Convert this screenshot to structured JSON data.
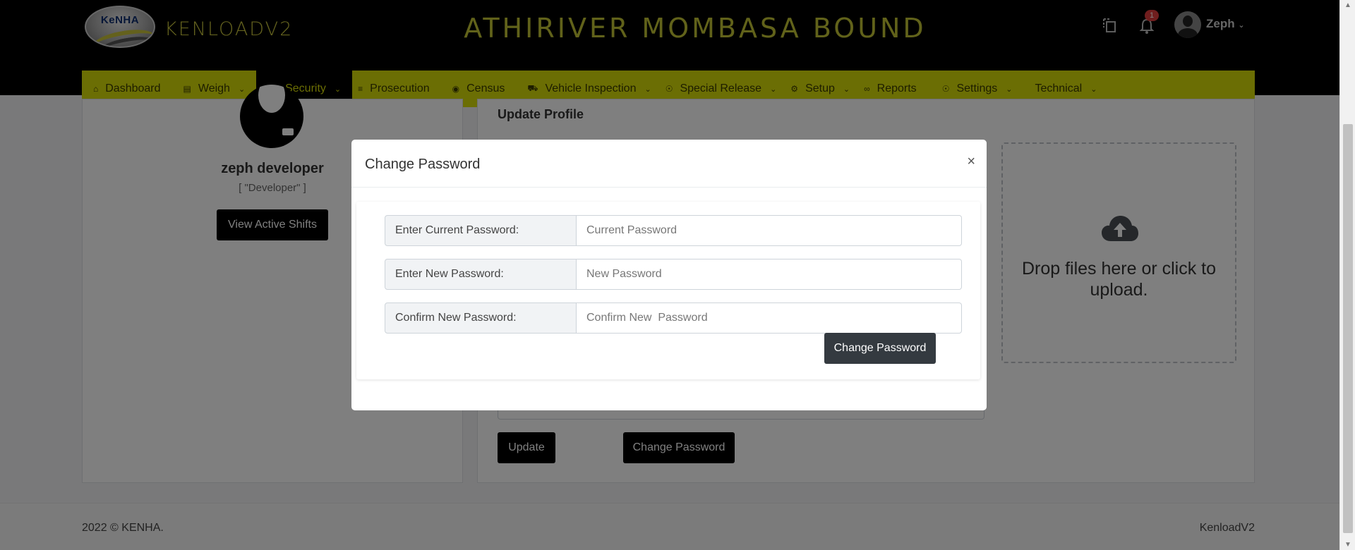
{
  "header": {
    "logo_text": "KeNHA",
    "brand": "KENLOADV2",
    "station": "ATHIRIVER MOMBASA BOUND",
    "notification_count": "1",
    "user_name": "Zeph"
  },
  "nav": {
    "items": [
      {
        "label": "Dashboard",
        "icon": "home-icon",
        "dropdown": false
      },
      {
        "label": "Weigh",
        "icon": "scale-icon",
        "dropdown": true
      },
      {
        "label": "Security",
        "icon": "lock-icon",
        "dropdown": true,
        "active": true
      },
      {
        "label": "Prosecution",
        "icon": "list-icon",
        "dropdown": false
      },
      {
        "label": "Census",
        "icon": "car-icon",
        "dropdown": false
      },
      {
        "label": "Vehicle Inspection",
        "icon": "truck-icon",
        "dropdown": true
      },
      {
        "label": "Special Release",
        "icon": "circle-dot-icon",
        "dropdown": true
      },
      {
        "label": "Setup",
        "icon": "cogs-icon",
        "dropdown": true
      },
      {
        "label": "Reports",
        "icon": "paperclip-icon",
        "dropdown": false
      },
      {
        "label": "Settings",
        "icon": "circle-dot-icon",
        "dropdown": true
      },
      {
        "label": "Technical",
        "icon": "",
        "dropdown": true
      }
    ]
  },
  "profile": {
    "name": "zeph developer",
    "role": "[ \"Developer\" ]",
    "view_shifts_label": "View Active Shifts"
  },
  "form": {
    "title": "Update Profile",
    "dropzone_text": "Drop files here or click to upload.",
    "update_label": "Update",
    "change_password_label": "Change Password"
  },
  "modal": {
    "title": "Change Password",
    "close_glyph": "×",
    "fields": [
      {
        "label": "Enter Current Password:",
        "placeholder": "Current Password",
        "value": ""
      },
      {
        "label": "Enter New Password:",
        "placeholder": "New Password",
        "value": ""
      },
      {
        "label": "Confirm New Password:",
        "placeholder": "Confirm New  Password",
        "value": ""
      }
    ],
    "submit_label": "Change Password"
  },
  "footer": {
    "copyright": "2022 © KENHA.",
    "app_name": "KenloadV2"
  },
  "colors": {
    "nav_bg": "#d7dc08",
    "header_bg": "#000000",
    "brand_text": "#c8c53d",
    "badge": "#e03c3c",
    "dark_button": "#343a40"
  }
}
